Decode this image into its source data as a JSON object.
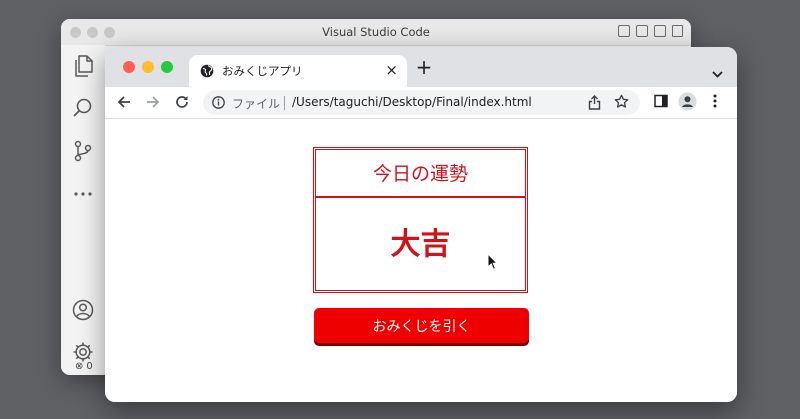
{
  "vscode": {
    "title": "Visual Studio Code",
    "activity_icons": [
      "files-icon",
      "search-icon",
      "source-control-icon",
      "more-icon",
      "account-icon",
      "settings-icon"
    ],
    "status": {
      "errors": "0"
    }
  },
  "browser": {
    "tab": {
      "title": "おみくじアプリ",
      "close_label": "×"
    },
    "new_tab_label": "+",
    "address": {
      "scheme_label": "ファイル",
      "url": "/Users/taguchi/Desktop/Final/index.html"
    }
  },
  "page": {
    "heading": "今日の運勢",
    "result": "大吉",
    "button_label": "おみくじを引く"
  },
  "colors": {
    "accent": "#d0121b",
    "button": "#ee0000",
    "button_shadow": "#7a0000"
  }
}
